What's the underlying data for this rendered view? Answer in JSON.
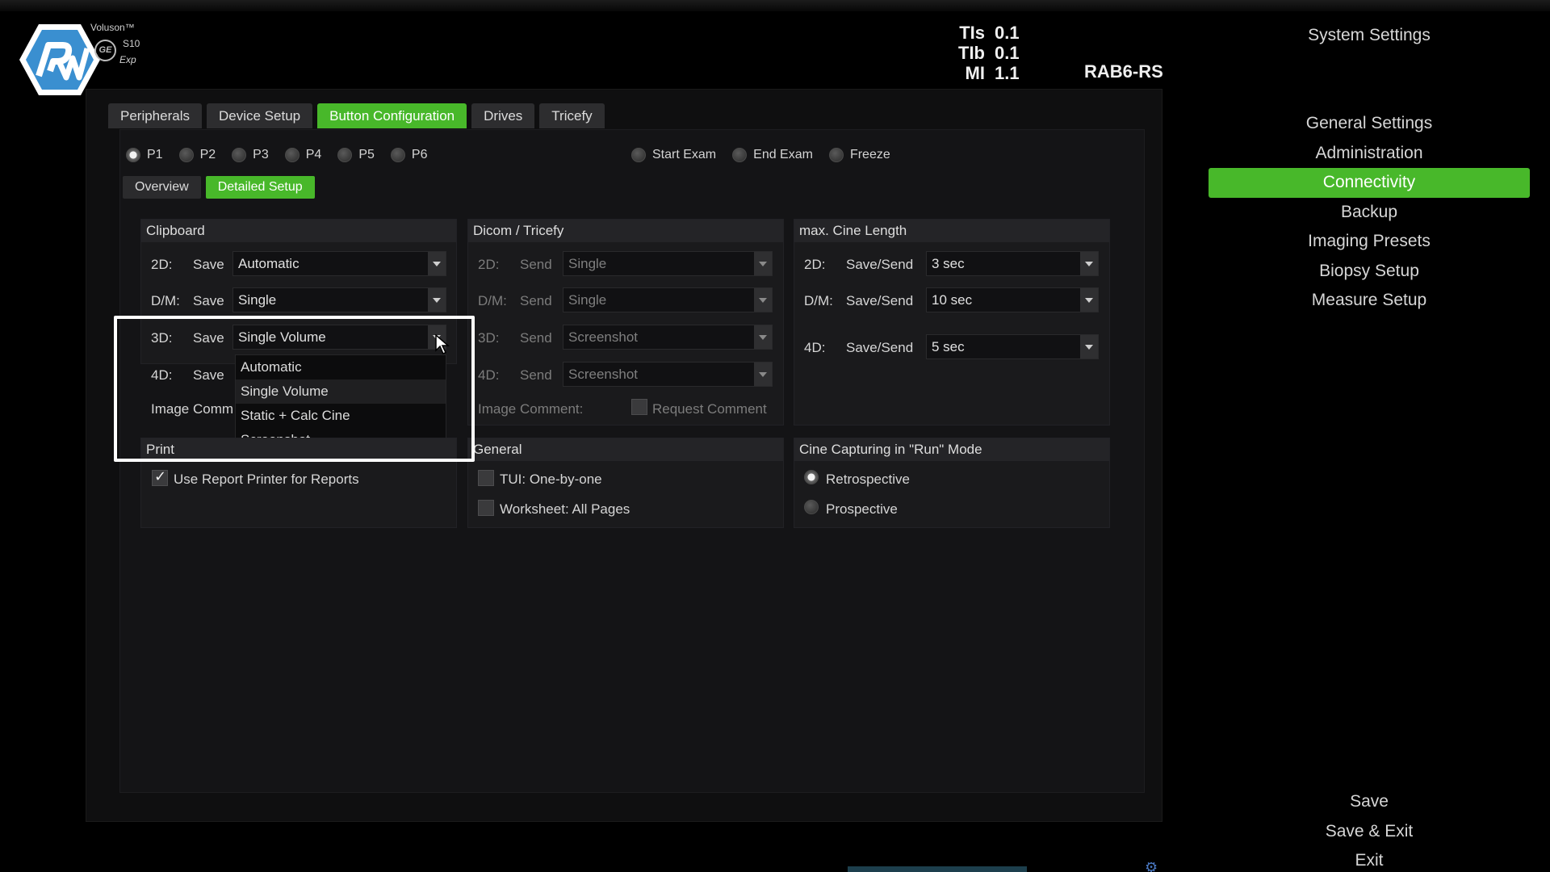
{
  "brand": {
    "product": "Voluson™",
    "model": "S10",
    "edition": "Exp",
    "ge_mark": "GE"
  },
  "readouts": [
    {
      "label": "TIs",
      "value": "0.1"
    },
    {
      "label": "TIb",
      "value": "0.1"
    },
    {
      "label": "MI",
      "value": "1.1"
    }
  ],
  "probe": "RAB6-RS",
  "tabs": [
    "Peripherals",
    "Device Setup",
    "Button Configuration",
    "Drives",
    "Tricefy"
  ],
  "active_tab": "Button Configuration",
  "presets": [
    "P1",
    "P2",
    "P3",
    "P4",
    "P5",
    "P6"
  ],
  "selected_preset": "P1",
  "actions": [
    "Start Exam",
    "End Exam",
    "Freeze"
  ],
  "subtabs": [
    "Overview",
    "Detailed Setup"
  ],
  "active_subtab": "Detailed Setup",
  "clipboard": {
    "title": "Clipboard",
    "rows": [
      {
        "mode": "2D:",
        "action": "Save",
        "value": "Automatic"
      },
      {
        "mode": "D/M:",
        "action": "Save",
        "value": "Single"
      },
      {
        "mode": "3D:",
        "action": "Save",
        "value": "Single Volume"
      },
      {
        "mode": "4D:",
        "action": "Save"
      }
    ],
    "image_comment_label": "Image Comm"
  },
  "dropdown_open": {
    "options": [
      "Automatic",
      "Single Volume",
      "Static + Calc Cine",
      "Screenshot"
    ],
    "selected": "Single Volume"
  },
  "dicom": {
    "title": "Dicom / Tricefy",
    "rows": [
      {
        "mode": "2D:",
        "action": "Send",
        "value": "Single"
      },
      {
        "mode": "D/M:",
        "action": "Send",
        "value": "Single"
      },
      {
        "mode": "3D:",
        "action": "Send",
        "value": "Screenshot"
      },
      {
        "mode": "4D:",
        "action": "Send",
        "value": "Screenshot"
      }
    ],
    "image_comment_label": "Image Comment:",
    "request_comment_label": "Request Comment",
    "request_comment_checked": false
  },
  "cine": {
    "title": "max. Cine Length",
    "rows": [
      {
        "mode": "2D:",
        "action": "Save/Send",
        "value": "3 sec"
      },
      {
        "mode": "D/M:",
        "action": "Save/Send",
        "value": "10 sec"
      },
      {
        "mode": "4D:",
        "action": "Save/Send",
        "value": "5 sec"
      }
    ]
  },
  "print": {
    "title": "Print",
    "use_report_printer_label": "Use Report Printer for Reports",
    "use_report_printer_checked": true
  },
  "general": {
    "title": "General",
    "tui_label": "TUI: One-by-one",
    "tui_checked": false,
    "worksheet_label": "Worksheet: All Pages",
    "worksheet_checked": false
  },
  "cine_capture": {
    "title": "Cine Capturing in \"Run\" Mode",
    "options": [
      "Retrospective",
      "Prospective"
    ],
    "selected": "Retrospective"
  },
  "system_menu": {
    "title": "System Settings",
    "items": [
      "General Settings",
      "Administration",
      "Connectivity",
      "Backup",
      "Imaging Presets",
      "Biopsy Setup",
      "Measure Setup"
    ],
    "active": "Connectivity",
    "footer": [
      "Save",
      "Save & Exit",
      "Exit"
    ]
  },
  "colors": {
    "accent_green": "#48b82a",
    "background": "#000000",
    "panel": "#141416"
  }
}
